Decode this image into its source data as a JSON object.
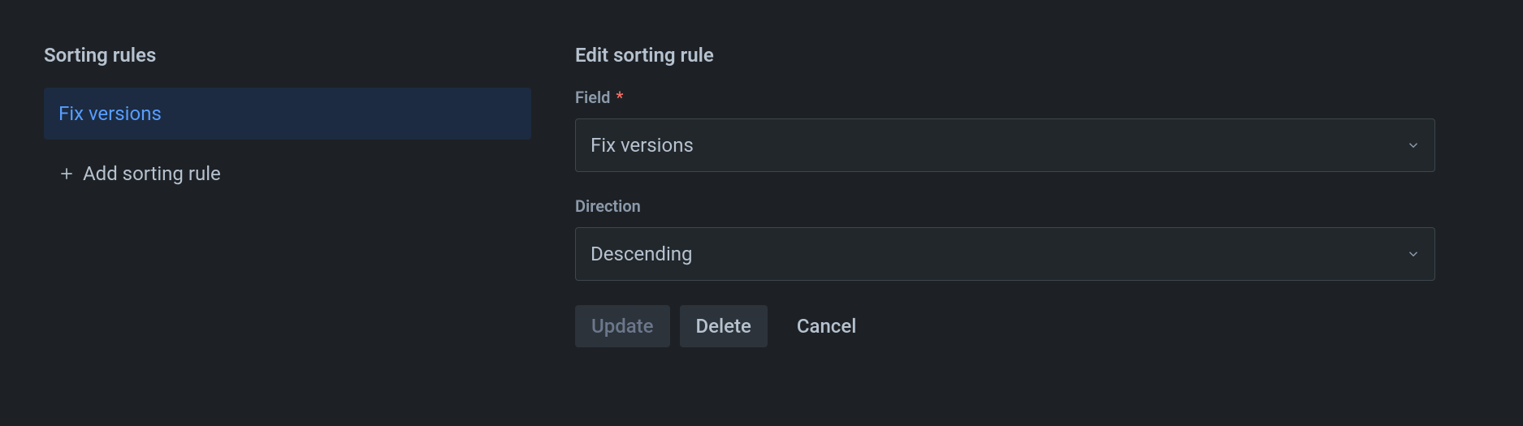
{
  "left": {
    "heading": "Sorting rules",
    "rules": [
      {
        "label": "Fix versions"
      }
    ],
    "add_label": "Add sorting rule"
  },
  "right": {
    "heading": "Edit sorting rule",
    "field": {
      "label": "Field",
      "required_mark": "*",
      "value": "Fix versions"
    },
    "direction": {
      "label": "Direction",
      "value": "Descending"
    },
    "buttons": {
      "update": "Update",
      "delete": "Delete",
      "cancel": "Cancel"
    }
  }
}
